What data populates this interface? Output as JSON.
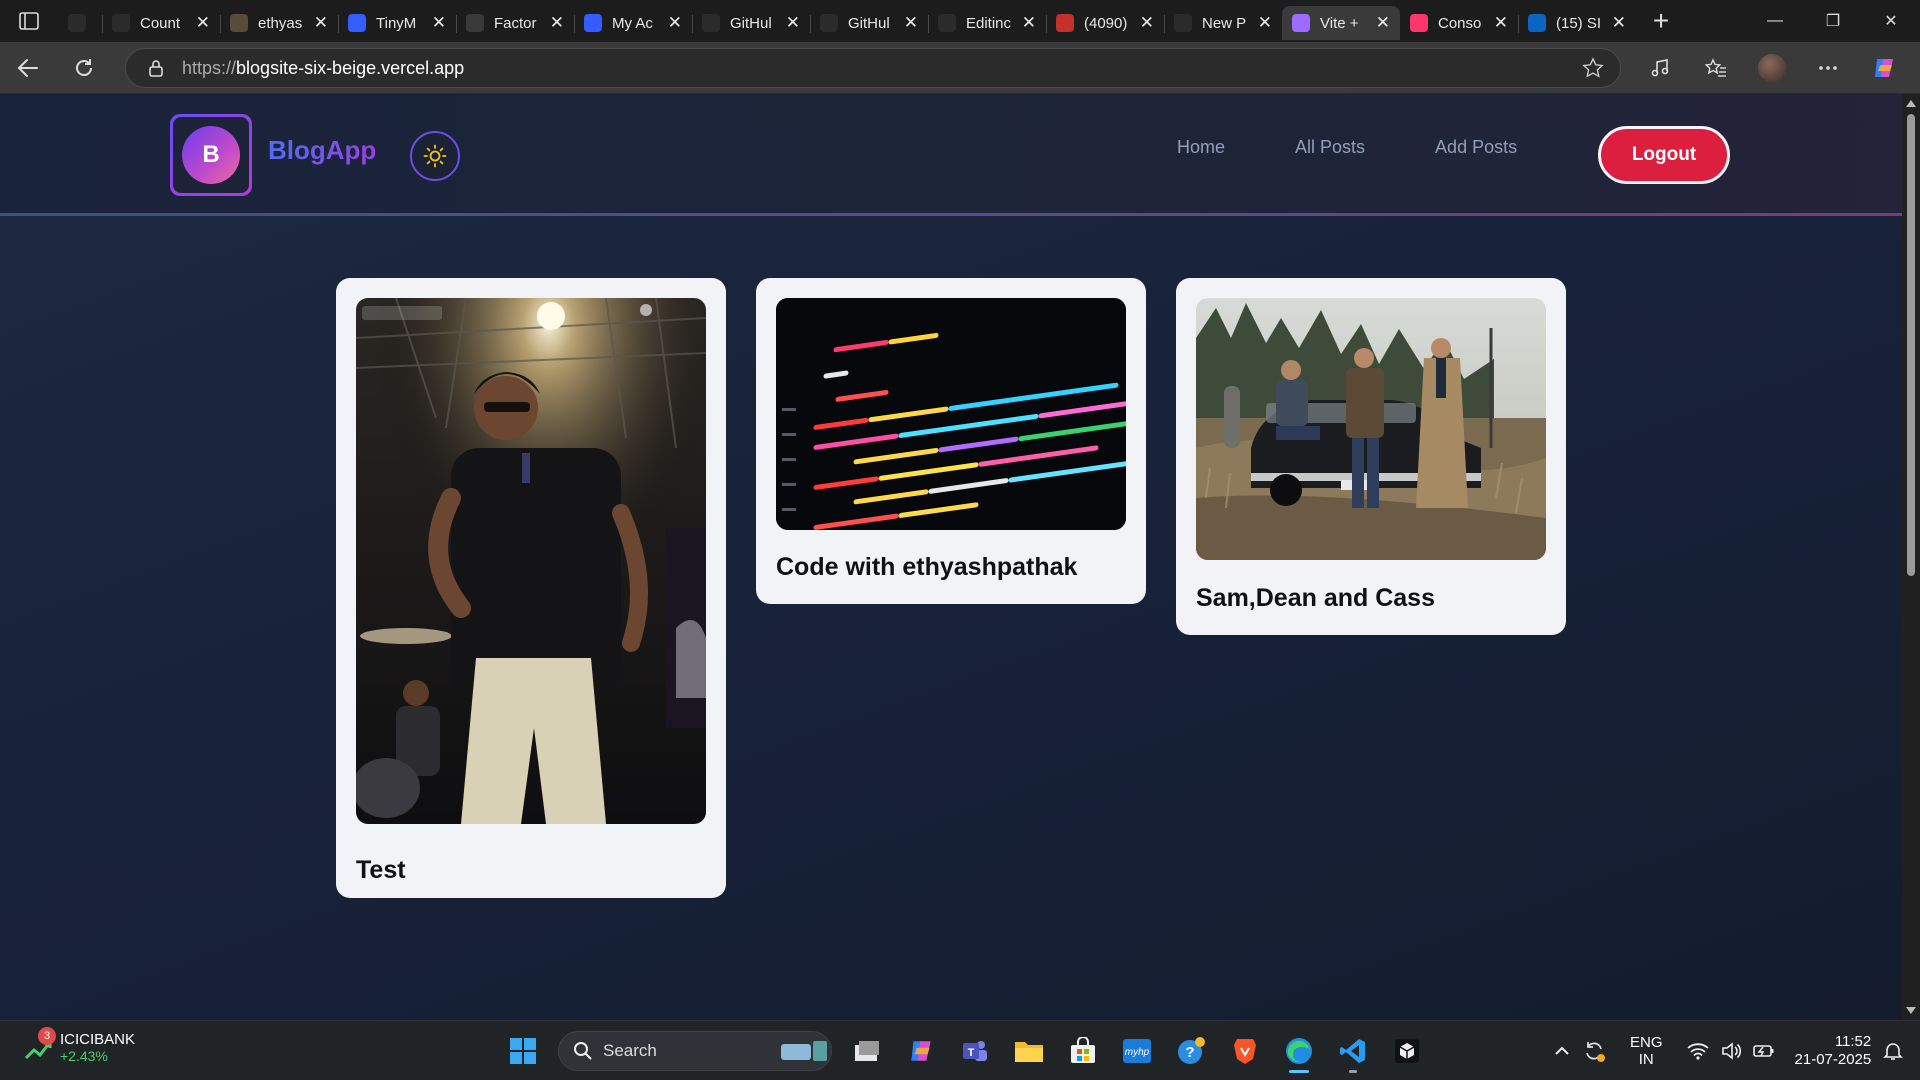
{
  "browser": {
    "tabs": [
      {
        "title": "",
        "favicon": "tuf-icon",
        "color": "#2b2b2b"
      },
      {
        "title": "Count",
        "favicon": "tuf-icon",
        "color": "#2b2b2b"
      },
      {
        "title": "ethyas",
        "favicon": "code-icon",
        "color": "#5a4a3a"
      },
      {
        "title": "TinyM",
        "favicon": "tinymce-icon",
        "color": "#335dff"
      },
      {
        "title": "Factor",
        "favicon": "openai-icon",
        "color": "#3a3a3a"
      },
      {
        "title": "My Ac",
        "favicon": "tinymce-icon",
        "color": "#335dff"
      },
      {
        "title": "GitHul",
        "favicon": "github-icon",
        "color": "#2b2b2b"
      },
      {
        "title": "GitHul",
        "favicon": "github-icon",
        "color": "#2b2b2b"
      },
      {
        "title": "Editinc",
        "favicon": "github-icon",
        "color": "#2b2b2b"
      },
      {
        "title": "(4090)",
        "favicon": "youtube-icon",
        "color": "#c4302b"
      },
      {
        "title": "New P",
        "favicon": "vercel-icon",
        "color": "#2b2b2b"
      },
      {
        "title": "Vite +",
        "favicon": "vite-icon",
        "color": "#9d6bff"
      },
      {
        "title": "Conso",
        "favicon": "appwrite-icon",
        "color": "#fd366e"
      },
      {
        "title": "(15) SI",
        "favicon": "linkedin-icon",
        "color": "#0a66c2"
      }
    ],
    "active_tab_index": 11,
    "url_protocol": "https://",
    "url_host": "blogsite-six-beige.vercel.app"
  },
  "site": {
    "logo_letter": "B",
    "brand": "BlogApp",
    "nav": [
      "Home",
      "All Posts",
      "Add Posts"
    ],
    "logout_label": "Logout"
  },
  "posts": [
    {
      "title": "Test",
      "image": "concert-singer-photo"
    },
    {
      "title": "Code with ethyashpathak",
      "image": "code-screen-photo"
    },
    {
      "title": "Sam,Dean and Cass",
      "image": "three-men-by-car-photo"
    }
  ],
  "taskbar": {
    "widget_name": "ICICIBANK",
    "widget_change": "+2.43%",
    "widget_badge": "3",
    "search_placeholder": "Search",
    "lang_line1": "ENG",
    "lang_line2": "IN",
    "time": "11:52",
    "date": "21-07-2025"
  }
}
